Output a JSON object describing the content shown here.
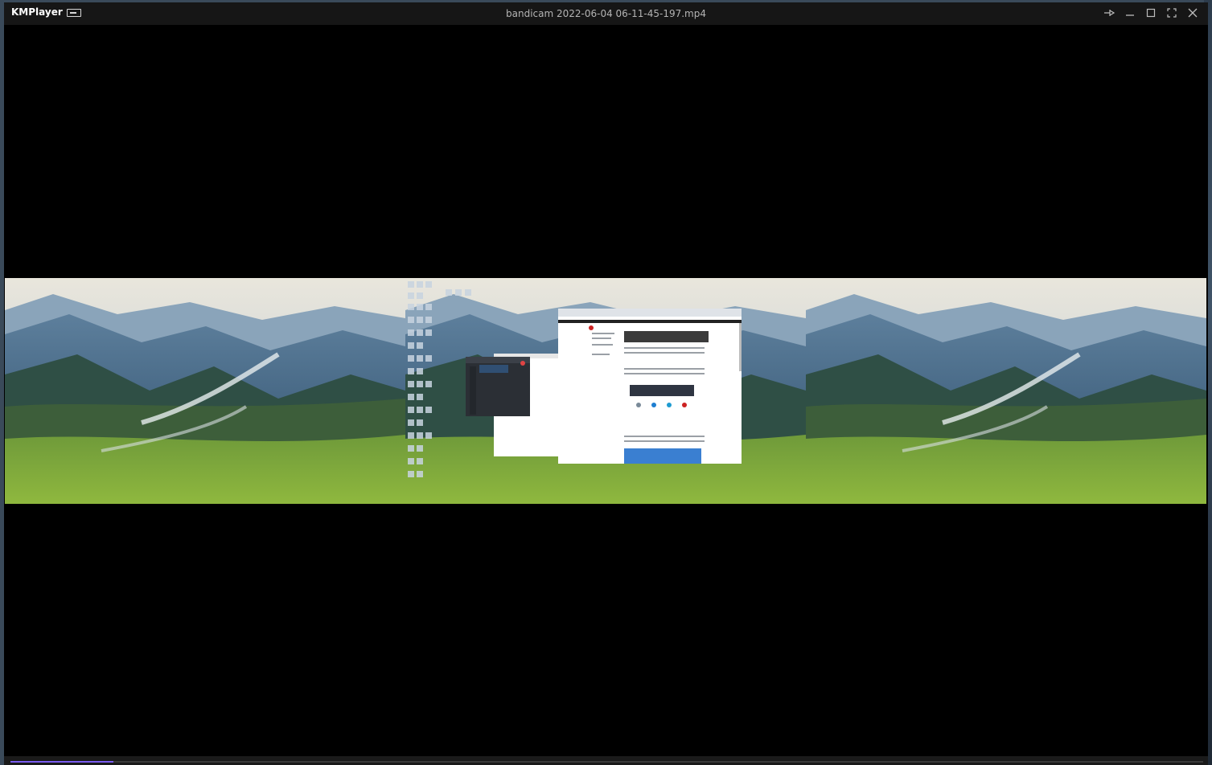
{
  "app": {
    "name": "KMPlayer",
    "file_title": "bandicam 2022-06-04 06-11-45-197.mp4"
  },
  "window_controls": [
    {
      "name": "pin-icon"
    },
    {
      "name": "minimize-icon"
    },
    {
      "name": "maximize-icon"
    },
    {
      "name": "fullscreen-icon"
    },
    {
      "name": "close-icon"
    }
  ],
  "playback": {
    "progress_fraction": 0.086
  },
  "colors": {
    "titlebar": "#161616",
    "progress": "#7b5cf0",
    "video_bg": "#000000"
  }
}
